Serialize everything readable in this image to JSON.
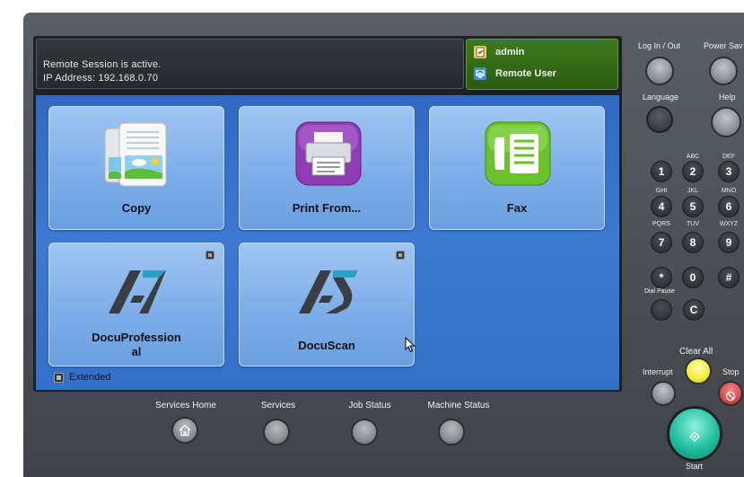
{
  "status": {
    "line1": "Remote Session is active.",
    "line2": "IP Address: 192.168.0.70"
  },
  "user": {
    "name": "admin",
    "type": "Remote User"
  },
  "tiles": [
    {
      "label": "Copy"
    },
    {
      "label": "Print From..."
    },
    {
      "label": "Fax"
    },
    {
      "label_line1": "DocuProfession",
      "label_line2": "al"
    },
    {
      "label": "DocuScan"
    }
  ],
  "extended_label": "Extended",
  "bottom_buttons": [
    {
      "label": "Services Home"
    },
    {
      "label": "Services"
    },
    {
      "label": "Job Status"
    },
    {
      "label": "Machine Status"
    }
  ],
  "side_panel": {
    "login_label": "Log In / Out",
    "power_save_label": "Power Sav",
    "language_label": "Language",
    "help_label": "Help",
    "dial_pause_label": "Dial Pause",
    "clear_all_label": "Clear All",
    "interrupt_label": "Interrupt",
    "stop_label": "Stop",
    "start_label": "Start",
    "keys": [
      {
        "key": "1",
        "sub": ""
      },
      {
        "key": "2",
        "sub": "ABC"
      },
      {
        "key": "3",
        "sub": "DEF"
      },
      {
        "key": "4",
        "sub": "GHI"
      },
      {
        "key": "5",
        "sub": "JKL"
      },
      {
        "key": "6",
        "sub": "MNO"
      },
      {
        "key": "7",
        "sub": "PQRS"
      },
      {
        "key": "8",
        "sub": "TUV"
      },
      {
        "key": "9",
        "sub": "WXYZ"
      },
      {
        "key": "*",
        "sub": ""
      },
      {
        "key": "0",
        "sub": ""
      },
      {
        "key": "#",
        "sub": ""
      },
      {
        "key": "C",
        "sub": ""
      }
    ]
  },
  "colors": {
    "screen_blue": "#3370c9",
    "tile_blue": "#7eaee9",
    "user_green": "#2a5a10",
    "clear_all_yellow": "#f3ec3a",
    "stop_red": "#d94b4b",
    "start_teal": "#1fbf9f"
  }
}
